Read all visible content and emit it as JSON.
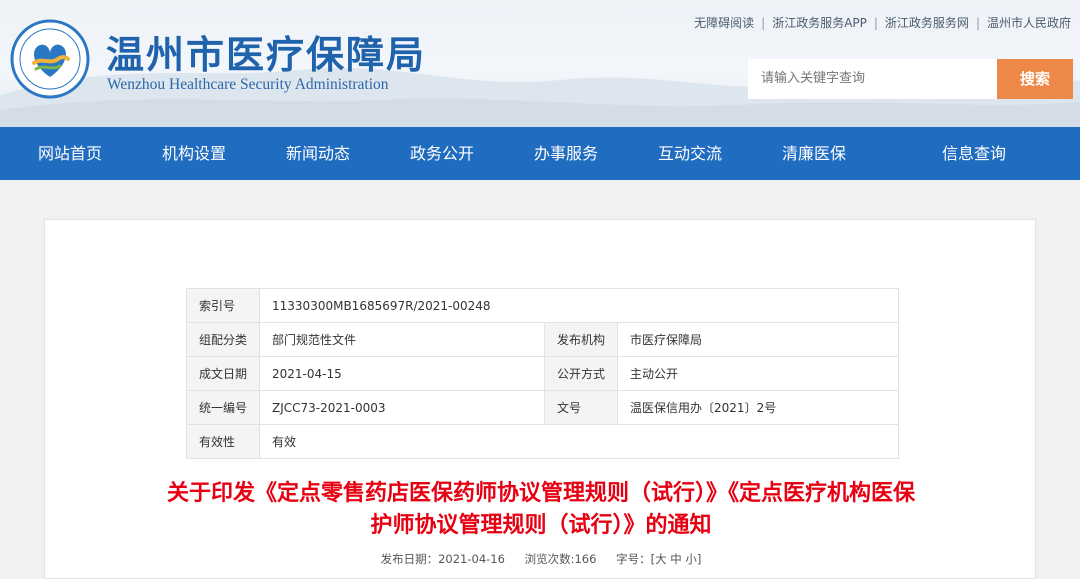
{
  "site": {
    "title_cn": "温州市医疗保障局",
    "title_en": "Wenzhou Healthcare Security Administration"
  },
  "toplinks": [
    "无障碍阅读",
    "浙江政务服务APP",
    "浙江政务服务网",
    "温州市人民政府"
  ],
  "search": {
    "placeholder": "请输入关键字查询",
    "button": "搜索"
  },
  "nav": [
    "网站首页",
    "机构设置",
    "新闻动态",
    "政务公开",
    "办事服务",
    "互动交流",
    "清廉医保",
    "信息查询"
  ],
  "meta": {
    "index_label": "索引号",
    "index_value": "11330300MB1685697R/2021-00248",
    "category_label": "组配分类",
    "category_value": "部门规范性文件",
    "publisher_label": "发布机构",
    "publisher_value": "市医疗保障局",
    "date_label": "成文日期",
    "date_value": "2021-04-15",
    "open_label": "公开方式",
    "open_value": "主动公开",
    "code_label": "统一编号",
    "code_value": "ZJCC73-2021-0003",
    "docno_label": "文号",
    "docno_value": "温医保信用办〔2021〕2号",
    "validity_label": "有效性",
    "validity_value": "有效"
  },
  "article": {
    "title_line1": "关于印发《定点零售药店医保药师协议管理规则（试行）》《定点医疗机构医保",
    "title_line2": "护师协议管理规则（试行）》的通知",
    "publish_date": "发布日期：2021-04-16",
    "views": "浏览次数:166",
    "fontsize": "字号：[大 中 小]"
  },
  "colors": {
    "brand": "#1f6cc0",
    "accent": "#ee8848",
    "title_red": "#e60012"
  }
}
